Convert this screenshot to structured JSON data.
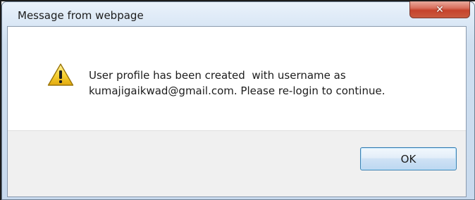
{
  "dialog": {
    "title": "Message from webpage",
    "close_label": "✕",
    "message_line1": "User profile has been created  with username as",
    "message_line2": "kumajigaikwad@gmail.com. Please re-login to continue.",
    "ok_label": "OK",
    "icon": "warning-icon"
  },
  "colors": {
    "close_button": "#c6432c",
    "warning_fill": "#f5c518",
    "ok_border": "#3c7fb1",
    "frame": "#c8daee"
  }
}
